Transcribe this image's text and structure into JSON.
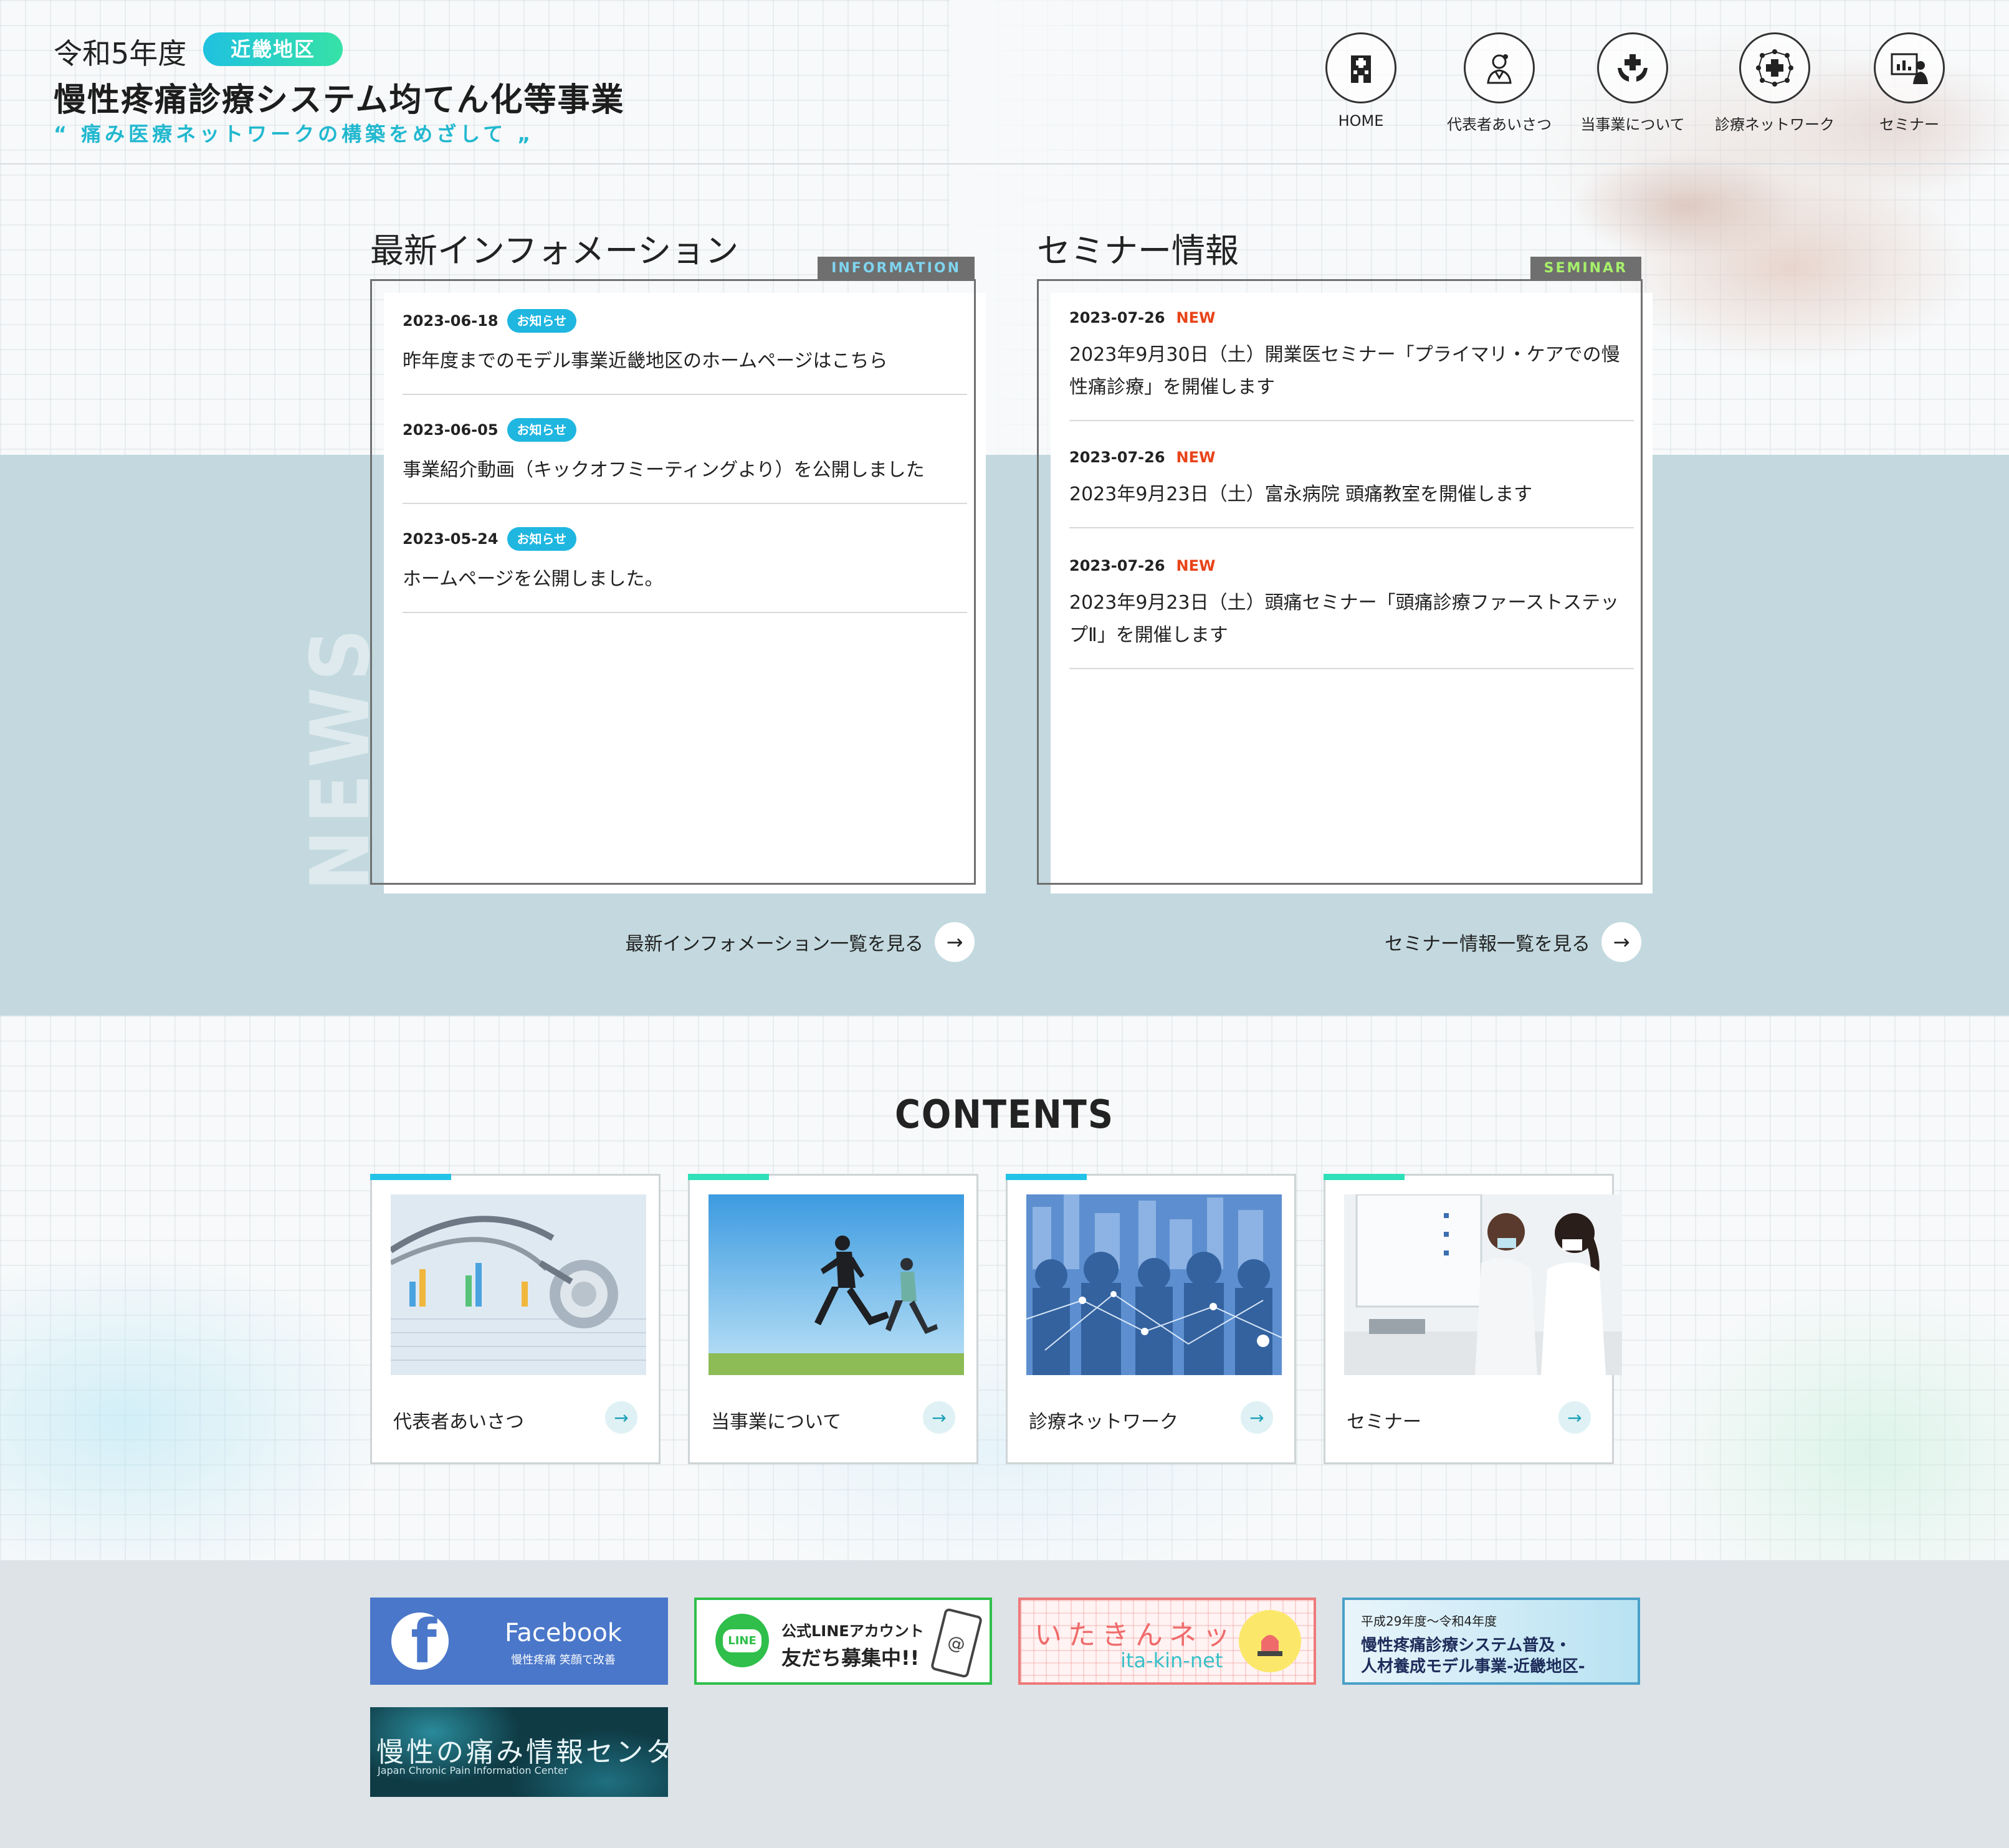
{
  "header": {
    "year": "令和5年度",
    "region_badge": "近畿地区",
    "title": "慢性疼痛診療システム均てん化等事業",
    "tagline": "“ 痛み医療ネットワークの構築をめざして „"
  },
  "nav": [
    {
      "label": "HOME",
      "icon": "hospital-icon"
    },
    {
      "label": "代表者あいさつ",
      "icon": "doctor-icon"
    },
    {
      "label": "当事業について",
      "icon": "hands-cross-icon"
    },
    {
      "label": "診療ネットワーク",
      "icon": "network-icon"
    },
    {
      "label": "セミナー",
      "icon": "presentation-icon"
    }
  ],
  "news": {
    "vertical_label": "NEWS",
    "info": {
      "title": "最新インフォメーション",
      "tag": "INFORMATION",
      "tag_color": "#7fd4f0",
      "entries": [
        {
          "date": "2023-06-18",
          "badge": "お知らせ",
          "title": "昨年度までのモデル事業近畿地区のホームページはこちら"
        },
        {
          "date": "2023-06-05",
          "badge": "お知らせ",
          "title": "事業紹介動画（キックオフミーティングより）を公開しました"
        },
        {
          "date": "2023-05-24",
          "badge": "お知らせ",
          "title": "ホームページを公開しました。"
        }
      ],
      "more": "最新インフォメーション一覧を見る"
    },
    "seminar": {
      "title": "セミナー情報",
      "tag": "SEMINAR",
      "tag_color": "#a6f06a",
      "entries": [
        {
          "date": "2023-07-26",
          "badge": "NEW",
          "title": "2023年9月30日（土）開業医セミナー「プライマリ・ケアでの慢性痛診療」を開催します"
        },
        {
          "date": "2023-07-26",
          "badge": "NEW",
          "title": "2023年9月23日（土）富永病院 頭痛教室を開催します"
        },
        {
          "date": "2023-07-26",
          "badge": "NEW",
          "title": "2023年9月23日（土）頭痛セミナー「頭痛診療ファーストステップⅡ」を開催します"
        }
      ],
      "more": "セミナー情報一覧を見る"
    }
  },
  "contents": {
    "heading": "CONTENTS",
    "cards": [
      {
        "label": "代表者あいさつ",
        "image": "stethoscope-chart-photo",
        "bar_color": "#22c3e6"
      },
      {
        "label": "当事業について",
        "image": "runners-photo",
        "bar_color": "#2fe0b8"
      },
      {
        "label": "診療ネットワーク",
        "image": "city-network-photo",
        "bar_color": "#22c3e6"
      },
      {
        "label": "セミナー",
        "image": "seminar-staff-photo",
        "bar_color": "#2fe0b8"
      }
    ]
  },
  "banners": {
    "facebook": {
      "title": "Facebook",
      "sub": "慢性疼痛 笑顔で改善"
    },
    "line": {
      "logo": "LINE",
      "top": "公式LINEアカウント",
      "main": "友だち募集中!!"
    },
    "itakin": {
      "jp": "いたきんネット",
      "en": "ita-kin-net"
    },
    "model": {
      "small": "平成29年度〜令和4年度",
      "line1": "慢性疼痛診療システム普及・",
      "line2": "人材養成モデル事業-近畿地区-"
    },
    "center": {
      "jp": "慢性の痛み情報センター",
      "en": "Japan Chronic Pain Information Center"
    }
  }
}
